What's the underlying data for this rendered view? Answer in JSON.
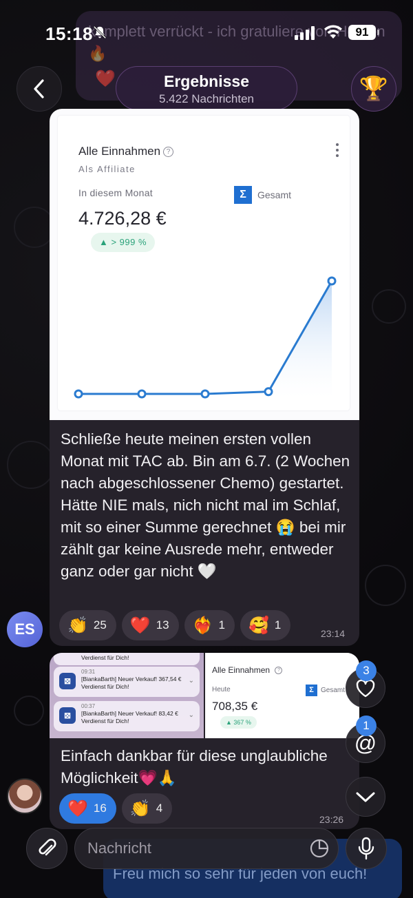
{
  "status_bar": {
    "time": "15:18",
    "battery": "91"
  },
  "background_message": {
    "text": "komplett verrückt - ich gratuliere von Herzen 🔥",
    "reaction": "❤️"
  },
  "header": {
    "title": "Ergebnisse",
    "subtitle": "5.422 Nachrichten",
    "trophy": "🏆"
  },
  "message1": {
    "card": {
      "title": "Alle Einnahmen",
      "help": "?",
      "subtitle": "Als Affiliate",
      "period_label": "In diesem Monat",
      "sigma": "Σ",
      "total_label": "Gesamt",
      "amount": "4.726,28 €",
      "change": "▲ > 999 %"
    },
    "chart_data": {
      "type": "line",
      "title": "",
      "xlabel": "",
      "ylabel": "",
      "x": [
        1,
        2,
        3,
        4,
        5
      ],
      "values": [
        0,
        0,
        0,
        2,
        100
      ],
      "ylim": [
        0,
        100
      ],
      "grid": false,
      "color": "#2a7bd0"
    },
    "text": "Schließe heute meinen ersten vollen Monat mit TAC ab. Bin am 6.7. (2 Wochen nach abgeschlossener Chemo) gestartet. Hätte NIE mals, nich nicht mal im Schlaf, mit so einer Summe gerechnet 😭 bei mir zählt gar keine Ausrede mehr, entweder ganz oder gar nicht 🤍",
    "reactions": [
      {
        "emoji": "👏",
        "count": "25"
      },
      {
        "emoji": "❤️",
        "count": "13"
      },
      {
        "emoji": "❤️‍🔥",
        "count": "1"
      },
      {
        "emoji": "🥰",
        "count": "1"
      }
    ],
    "time": "23:14",
    "sender_initials": "ES"
  },
  "message2": {
    "notifications": [
      {
        "time": "",
        "text": "Verdienst für Dich!"
      },
      {
        "time": "09:31",
        "text": "[BiankaBarth] Neuer Verkauf! 367,54 € Verdienst für Dich!"
      },
      {
        "time": "00:37",
        "text": "[BiankaBarth] Neuer Verkauf! 83,42 € Verdienst für Dich!"
      }
    ],
    "right_card": {
      "title": "Alle Einnahmen",
      "today_label": "Heute",
      "sigma": "Σ",
      "total_label": "Gesamt",
      "amount": "708,35 €",
      "change": "▲ 367 %"
    },
    "text": "Einfach dankbar für diese unglaubliche Möglichkeit💗🙏",
    "reactions": [
      {
        "emoji": "❤️",
        "count": "16",
        "mine": true
      },
      {
        "emoji": "👏",
        "count": "4"
      }
    ],
    "time": "23:26"
  },
  "floating": {
    "reactions_badge": "3",
    "mentions_badge": "1"
  },
  "composer": {
    "placeholder": "Nachricht",
    "behind_text": "Freu mich so sehr für jeden von euch!"
  }
}
